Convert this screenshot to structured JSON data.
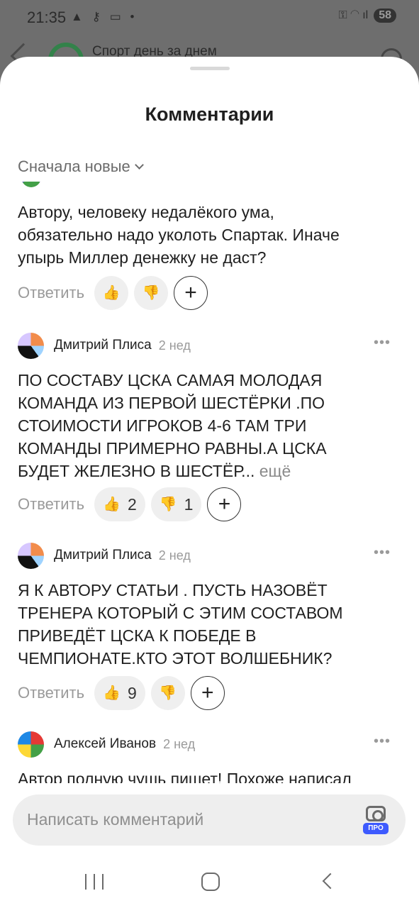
{
  "status_bar": {
    "time": "21:35",
    "left_icons": "▲ ⚷ ▭ •",
    "right_icons": "⚿ ◠ ıl",
    "battery": "58"
  },
  "background_header": {
    "channel_name": "Спорт день за днем"
  },
  "sheet": {
    "title": "Комментарии",
    "sort_label": "Сначала новые"
  },
  "comments": [
    {
      "author": "",
      "time": "",
      "lines": [
        "Автору, человеку недалёкого ума,",
        "обязательно надо уколоть Спартак. Иначе",
        "упырь Миллер денежку не даст?"
      ],
      "tail": "",
      "reply": "Ответить",
      "likes": "",
      "dislikes": ""
    },
    {
      "author": "Дмитрий Плиса",
      "time": "2 нед",
      "more": "•••",
      "lines": [
        "ПО СОСТАВУ ЦСКА САМАЯ МОЛОДАЯ",
        "КОМАНДА ИЗ ПЕРВОЙ ШЕСТЁРКИ .ПО",
        "СТОИМОСТИ ИГРОКОВ 4-6 ТАМ ТРИ",
        "КОМАНДЫ ПРИМЕРНО РАВНЫ.А ЦСКА",
        "БУДЕТ ЖЕЛЕЗНО В  ШЕСТЁР..."
      ],
      "tail": "ещё",
      "reply": "Ответить",
      "likes": "2",
      "dislikes": "1"
    },
    {
      "author": "Дмитрий Плиса",
      "time": "2 нед",
      "more": "•••",
      "lines": [
        "Я К АВТОРУ СТАТЬИ . ПУСТЬ НАЗОВЁТ",
        "ТРЕНЕРА КОТОРЫЙ С ЭТИМ СОСТАВОМ",
        "ПРИВЕДЁТ ЦСКА К ПОБЕДЕ В",
        "ЧЕМПИОНАТЕ.КТО ЭТОТ ВОЛШЕБНИК?"
      ],
      "tail": "",
      "reply": "Ответить",
      "likes": "9",
      "dislikes": ""
    },
    {
      "author": "Алексей Иванов",
      "time": "2 нед",
      "more": "•••",
      "lines": [
        "Автор полную чушь пишет! Похоже написал"
      ],
      "tail": "",
      "reply": "",
      "likes": "",
      "dislikes": ""
    }
  ],
  "icons": {
    "like": "👍",
    "dislike": "👎",
    "add": "+"
  },
  "composer": {
    "placeholder": "Написать комментарий",
    "pro_badge": "ПРО"
  },
  "colors": {
    "accent_pro": "#3d5afe",
    "channel_logo": "#1a8a3b"
  }
}
